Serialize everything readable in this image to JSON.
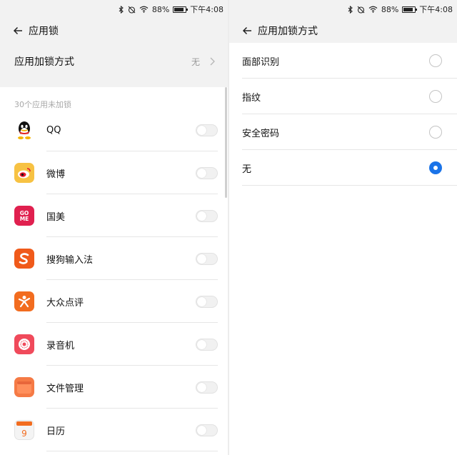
{
  "status_bar": {
    "battery": "88%",
    "time": "下午4:08",
    "icons": [
      "bluetooth-icon",
      "alarm-off-icon",
      "wifi-icon",
      "battery-icon"
    ]
  },
  "left": {
    "title": "应用锁",
    "lock_method": {
      "label": "应用加锁方式",
      "value": "无"
    },
    "section_label": "30个应用未加锁",
    "apps": [
      {
        "name": "QQ",
        "icon": "qq-icon",
        "color": "#ffffff",
        "locked": false
      },
      {
        "name": "微博",
        "icon": "weibo-icon",
        "color": "#f7c243",
        "locked": false
      },
      {
        "name": "国美",
        "icon": "gome-icon",
        "color": "#e0204f",
        "locked": false
      },
      {
        "name": "搜狗输入法",
        "icon": "sogou-icon",
        "color": "#f05a1a",
        "locked": false
      },
      {
        "name": "大众点评",
        "icon": "dianping-icon",
        "color": "#f26c1f",
        "locked": false
      },
      {
        "name": "录音机",
        "icon": "recorder-icon",
        "color": "#f04a5b",
        "locked": false
      },
      {
        "name": "文件管理",
        "icon": "file-manager-icon",
        "color": "#f57a45",
        "locked": false
      },
      {
        "name": "日历",
        "icon": "calendar-icon",
        "color": "#f0f0f0",
        "locked": false
      }
    ]
  },
  "right": {
    "title": "应用加锁方式",
    "options": [
      {
        "label": "面部识别",
        "selected": false
      },
      {
        "label": "指纹",
        "selected": false
      },
      {
        "label": "安全密码",
        "selected": false
      },
      {
        "label": "无",
        "selected": true
      }
    ],
    "accent_color": "#1a73e8"
  }
}
